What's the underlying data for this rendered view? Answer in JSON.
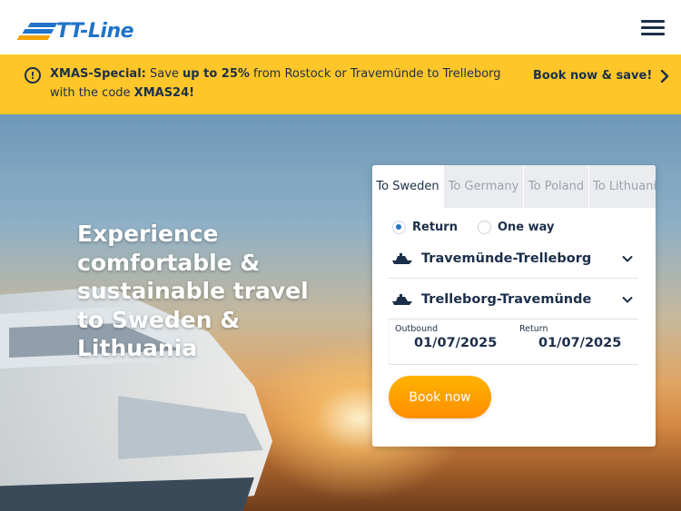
{
  "header": {
    "logo_text": "TT-Line",
    "menu_icon": "hamburger-menu-icon"
  },
  "promo": {
    "icon": "exclamation-circle-icon",
    "prefix": "XMAS-Special:",
    "t1": " Save ",
    "highlight": "up to 25%",
    "t2": " from Rostock or Travemünde to Trelleborg with the code ",
    "code": "XMAS24!",
    "cta_label": "Book now & save!",
    "cta_icon": "chevron-right-icon"
  },
  "hero": {
    "title": "Experience comfortable & sustainable travel to Sweden & Lithuania"
  },
  "booking": {
    "tabs": [
      {
        "label": "To Sweden",
        "active": true
      },
      {
        "label": "To Germany",
        "active": false
      },
      {
        "label": "To Poland",
        "active": false
      },
      {
        "label": "To Lithuania",
        "active": false
      }
    ],
    "trip_type": {
      "return_label": "Return",
      "one_way_label": "One way",
      "selected": "Return"
    },
    "routes": [
      {
        "label": "Travemünde-Trelleborg",
        "icon": "ferry-icon"
      },
      {
        "label": "Trelleborg-Travemünde",
        "icon": "ferry-icon"
      }
    ],
    "dates": {
      "outbound_caption": "Outbound",
      "outbound_value": "01/07/2025",
      "return_caption": "Return",
      "return_value": "01/07/2025"
    },
    "book_button": "Book now"
  },
  "colors": {
    "brand_blue": "#1f74c9",
    "brand_yellow": "#ffc629",
    "navy_text": "#1c2f4a",
    "button_orange": "#ff9d00"
  }
}
